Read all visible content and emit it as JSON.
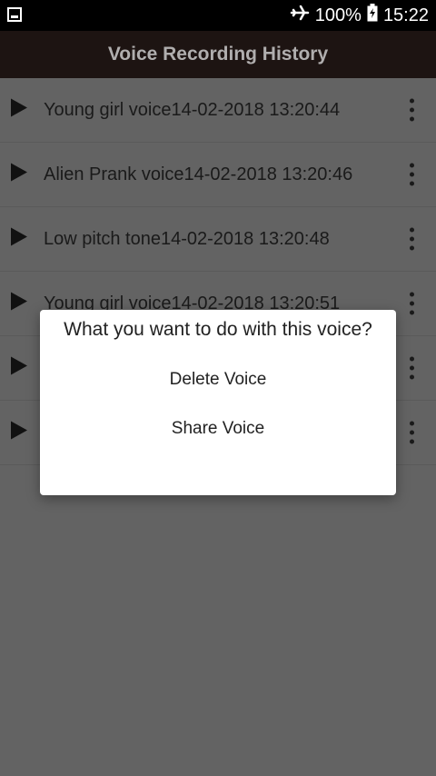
{
  "status_bar": {
    "battery_percent": "100%",
    "time": "15:22",
    "icons": [
      "gallery-icon",
      "airplane-icon",
      "battery-icon"
    ]
  },
  "app_bar": {
    "title": "Voice Recording History"
  },
  "recordings": [
    {
      "name": "Young girl voice14-02-2018 13:20:44"
    },
    {
      "name": "Alien Prank voice14-02-2018 13:20:46"
    },
    {
      "name": "Low pitch tone14-02-2018 13:20:48"
    },
    {
      "name": "Young girl voice14-02-2018 13:20:51"
    },
    {
      "name": ""
    },
    {
      "name": ""
    }
  ],
  "dialog": {
    "title": "What you want to do with this voice?",
    "options": [
      "Delete Voice",
      "Share Voice"
    ]
  },
  "colors": {
    "status_bar": "#000000",
    "app_bar": "#1d1412",
    "background_dimmed": "#636363",
    "dialog": "#ffffff"
  }
}
